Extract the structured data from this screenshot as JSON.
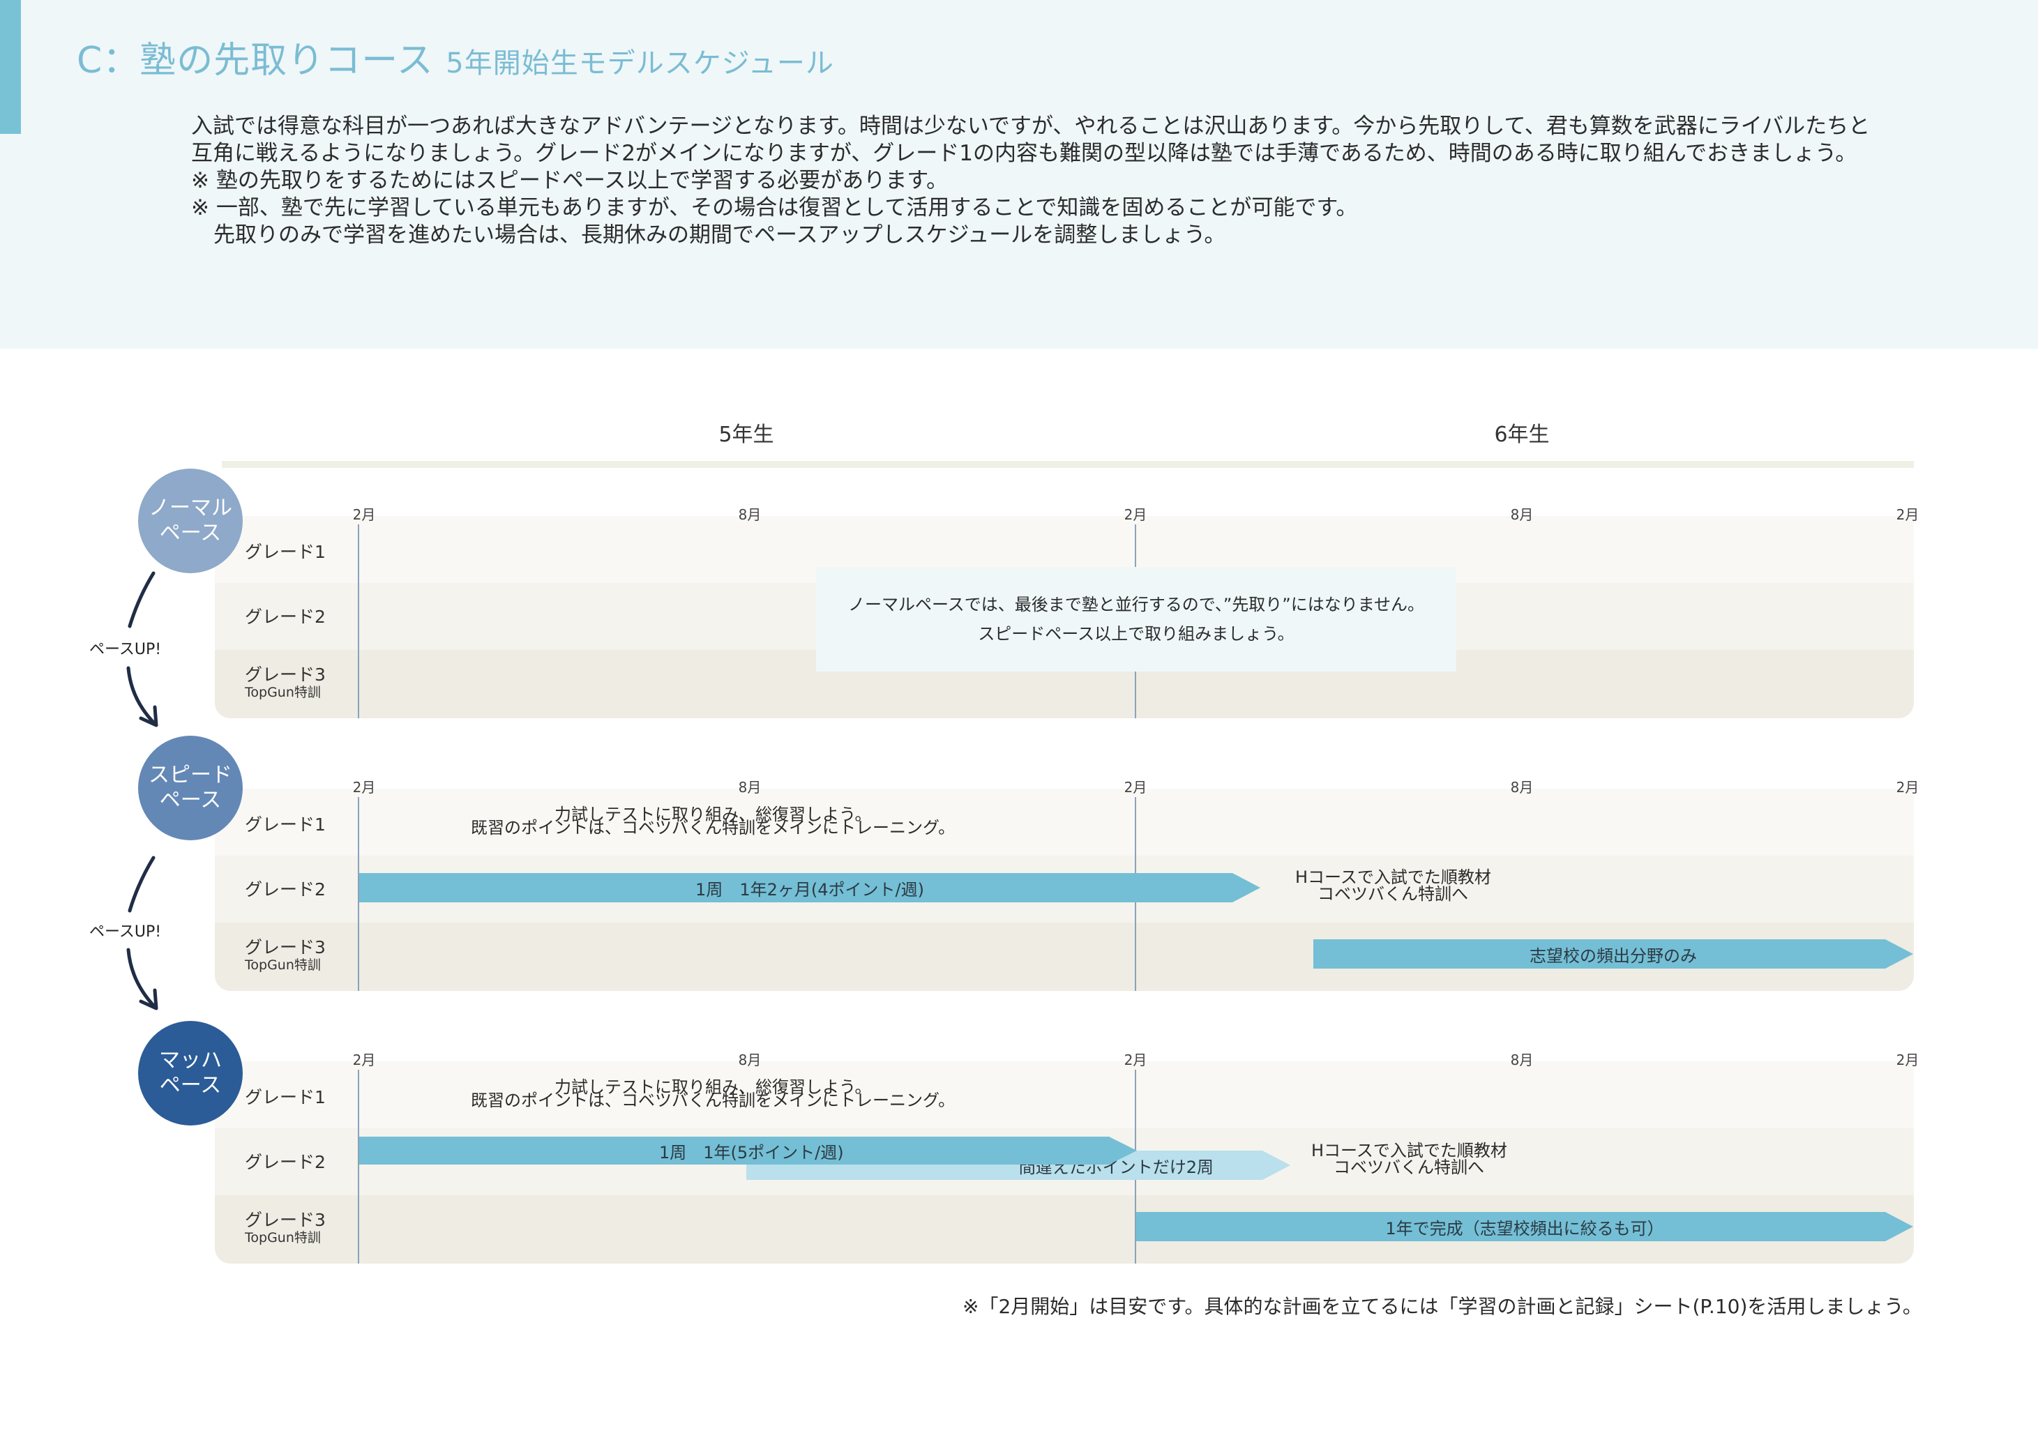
{
  "title": {
    "main": "C：塾の先取りコース",
    "sub": "5年開始生モデルスケジュール"
  },
  "intro": {
    "p1": "入試では得意な科目が一つあれば大きなアドバンテージとなります。時間は少ないですが、やれることは沢山あります。今から先取りして、君も算数を武器にライバルたちと互角に戦えるようになりましょう。グレード2がメインになりますが、グレード1の内容も難関の型以降は塾では手薄であるため、時間のある時に取り組んでおきましょう。",
    "n1": "※ 塾の先取りをするためにはスピードペース以上で学習する必要があります。",
    "n2": "※ 一部、塾で先に学習している単元もありますが、その場合は復習として活用することで知識を固めることが可能です。",
    "n3": "先取りのみで学習を進めたい場合は、長期休みの期間でペースアップしスケジュールを調整しましょう。"
  },
  "years": [
    "5年生",
    "6年生"
  ],
  "months": [
    "2月",
    "8月",
    "2月",
    "8月",
    "2月"
  ],
  "grades": {
    "g1": "グレード1",
    "g2": "グレード2",
    "g3": "グレード3",
    "g3_sub": "TopGun特訓"
  },
  "pace_up": "ペースUP!",
  "paces": [
    {
      "line1": "ノーマル",
      "line2": "ペース",
      "color": "#8ea9c9"
    },
    {
      "line1": "スピード",
      "line2": "ペース",
      "color": "#6488b6"
    },
    {
      "line1": "マッハ",
      "line2": "ペース",
      "color": "#2b5c97"
    }
  ],
  "normal": {
    "note1": "ノーマルペースでは、最後まで塾と並行するので、”先取り”にはなりません。",
    "note2": "スピードペース以上で取り組みましょう。"
  },
  "speed": {
    "g1_note1": "力試しテストに取り組み、総復習しよう。",
    "g1_note2": "既習のポイントは、コベツバくん特訓をメインにトレーニング。",
    "g2_bar": "1周　1年2ヶ月(4ポイント/週)",
    "g2_after1": "Hコースで入試でた順教材",
    "g2_after2": "コベツバくん特訓へ",
    "g3_bar": "志望校の頻出分野のみ"
  },
  "mach": {
    "g1_note1": "力試しテストに取り組み、総復習しよう。",
    "g1_note2": "既習のポイントは、コベツバくん特訓をメインにトレーニング。",
    "g2_bar": "1周　1年(5ポイント/週)",
    "g2_bar2": "間違えたポイントだけ2周",
    "g2_after1": "Hコースで入試でた順教材",
    "g2_after2": "コベツバくん特訓へ",
    "g3_bar": "1年で完成（志望校頻出に絞るも可）"
  },
  "footnote": "※「2月開始」は目安です。具体的な計画を立てるには「学習の計画と記録」シート(P.10)を活用しましょう。"
}
